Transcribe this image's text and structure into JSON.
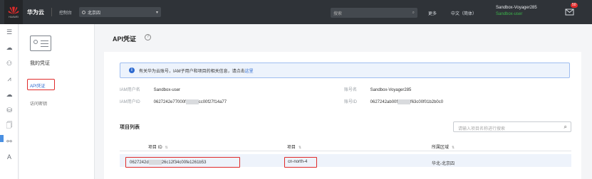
{
  "topbar": {
    "logo_text": "HUAWEI",
    "brand": "华为云",
    "console": "控制台",
    "region": "北京四",
    "search_placeholder": "搜索",
    "more": "更多",
    "lang": "中文（简体）",
    "username": "Sandbox-Voyager285",
    "user_status": "Sandbox-user",
    "badge": "50"
  },
  "sidenav": {
    "title": "我的凭证",
    "items": [
      "API凭证",
      "访问密钥"
    ]
  },
  "page": {
    "title": "API凭证",
    "notice_text": "有关华为云账号，IAM子用户和项目的相关信息，请点击",
    "notice_link": "这里",
    "iam_user_label": "IAM用户名",
    "iam_user_value": "Sandbox-user",
    "iam_id_label": "IAM用户ID",
    "iam_id_value_a": "0627242e77000f",
    "iam_id_value_b": "cc00f27f14a77",
    "account_label": "账号名",
    "account_value": "Sandbox-Voyager285",
    "account_id_label": "账号ID",
    "account_id_value_a": "0627242ab00f",
    "account_id_value_b": "f63c00f01b2b0c0",
    "list_title": "项目列表",
    "table_search_placeholder": "请输入项目名称进行搜索"
  },
  "table": {
    "columns": [
      "项目 ID",
      "项目",
      "所属区域"
    ],
    "rows": [
      {
        "id_a": "0627242d",
        "id_b": "26c12f34c00fe1261b53",
        "project": "cn-north-4",
        "region": "华北-北京四"
      }
    ]
  },
  "colors": {
    "highlight": "#e02b2b",
    "link": "#2d6ad0",
    "topbar": "#2f3338"
  }
}
